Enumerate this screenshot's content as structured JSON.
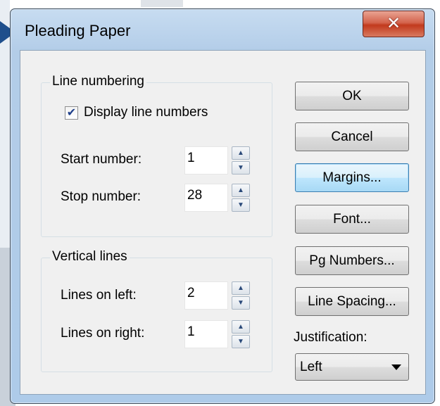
{
  "window": {
    "title": "Pleading Paper",
    "close_glyph": "✕"
  },
  "line_numbering": {
    "group_label": "Line numbering",
    "display_checkbox": {
      "label": "Display line numbers",
      "checked": true
    },
    "start_number": {
      "label": "Start number:",
      "value": "1"
    },
    "stop_number": {
      "label": "Stop number:",
      "value": "28"
    }
  },
  "vertical_lines": {
    "group_label": "Vertical lines",
    "lines_left": {
      "label": "Lines on left:",
      "value": "2"
    },
    "lines_right": {
      "label": "Lines on right:",
      "value": "1"
    }
  },
  "buttons": {
    "ok": "OK",
    "cancel": "Cancel",
    "margins": "Margins...",
    "font": "Font...",
    "pg_numbers": "Pg Numbers...",
    "line_spacing": "Line Spacing..."
  },
  "justification": {
    "label": "Justification:",
    "value": "Left"
  },
  "icons": {
    "close": "close-icon",
    "check": "check-icon",
    "spin_up": "spin-up-arrow-icon",
    "spin_down": "spin-down-arrow-icon",
    "dropdown": "chevron-down-icon"
  },
  "colors": {
    "title_bar": "#b3cde8",
    "close_button": "#c9462b",
    "client_bg": "#f0f0f0",
    "focus_button": "#bee6fd",
    "pointer_arrow": "#1f4f8c"
  }
}
